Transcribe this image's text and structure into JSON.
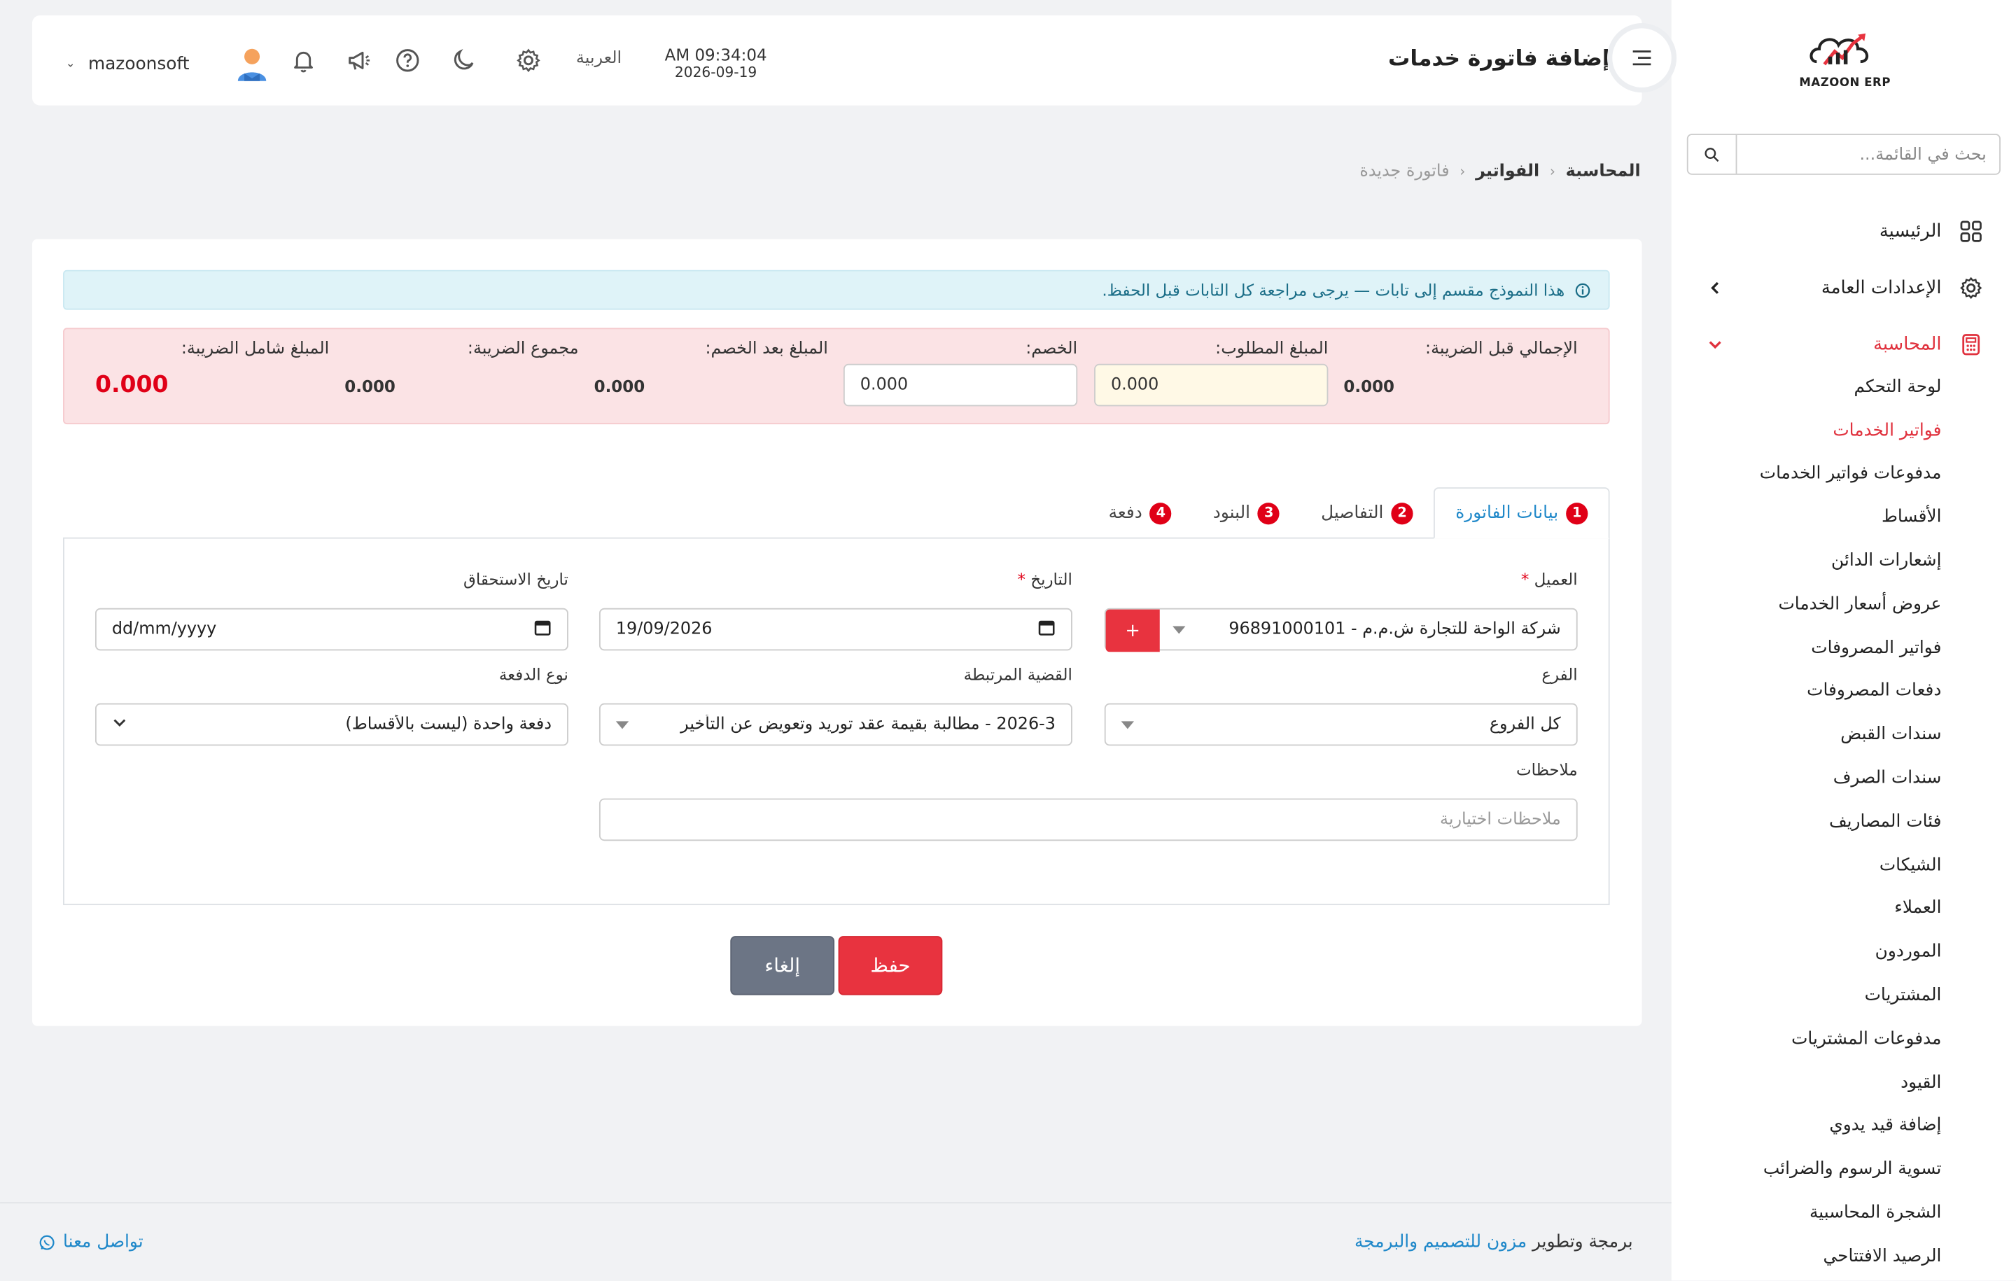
{
  "app": {
    "logo_text": "MAZOON ERP",
    "page_title": "إضافة فاتورة خدمات"
  },
  "header": {
    "time": "AM 09:34:04",
    "date": "2026-09-19",
    "language": "العربية",
    "username": "mazoonsoft"
  },
  "sidebar": {
    "search_placeholder": "بحث في القائمة...",
    "main_items": [
      {
        "label": "الرئيسية",
        "icon": "grid-icon"
      },
      {
        "label": "الإعدادات العامة",
        "icon": "gear-icon"
      },
      {
        "label": "المحاسبة",
        "icon": "calculator-icon"
      }
    ],
    "sub_items": [
      "لوحة التحكم",
      "فواتير الخدمات",
      "مدفوعات فواتير الخدمات",
      "الأقساط",
      "إشعارات الدائن",
      "عروض أسعار الخدمات",
      "فواتير المصروفات",
      "دفعات المصروفات",
      "سندات القبض",
      "سندات الصرف",
      "فئات المصاريف",
      "الشيكات",
      "العملاء",
      "الموردون",
      "المشتريات",
      "مدفوعات المشتريات",
      "القيود",
      "إضافة قيد يدوي",
      "تسوية الرسوم والضرائب",
      "الشجرة المحاسبية",
      "الرصيد الافتتاحي"
    ]
  },
  "breadcrumb": {
    "level1": "المحاسبة",
    "level2": "الفواتير",
    "current": "فاتورة جديدة"
  },
  "alert": {
    "text": "هذا النموذج مقسم إلى تابات — يرجى مراجعة كل التابات قبل الحفظ."
  },
  "summary": {
    "subtotal_label": "الإجمالي قبل الضريبة:",
    "subtotal_value": "0.000",
    "required_label": "المبلغ المطلوب:",
    "required_value": "0.000",
    "discount_label": "الخصم:",
    "discount_value": "0.000",
    "after_discount_label": "المبلغ بعد الخصم:",
    "after_discount_value": "0.000",
    "tax_total_label": "مجموع الضريبة:",
    "tax_total_value": "0.000",
    "grand_total_label": "المبلغ شامل الضريبة:",
    "grand_total_value": "0.000"
  },
  "tabs": [
    {
      "num": "1",
      "label": "بيانات الفاتورة"
    },
    {
      "num": "2",
      "label": "التفاصيل"
    },
    {
      "num": "3",
      "label": "البنود"
    },
    {
      "num": "4",
      "label": "دفعة"
    }
  ],
  "form": {
    "client_label": "العميل",
    "client_value": "شركة الواحة للتجارة ش.م.م - 96891000101",
    "add_label": "+",
    "date_label": "التاريخ",
    "date_value": "19/09/2026",
    "due_date_label": "تاريخ الاستحقاق",
    "due_date_value": "dd/mm/yyyy",
    "branch_label": "الفرع",
    "branch_value": "كل الفروع",
    "case_label": "القضية المرتبطة",
    "case_value": "2026-3 - مطالبة بقيمة عقد توريد وتعويض عن التأخير",
    "payment_type_label": "نوع الدفعة",
    "payment_type_value": "دفعة واحدة (ليست بالأقساط)",
    "notes_label": "ملاحظات",
    "notes_placeholder": "ملاحظات اختيارية",
    "required_mark": "*"
  },
  "actions": {
    "save": "حفظ",
    "cancel": "إلغاء"
  },
  "footer": {
    "credit_prefix": "برمجة وتطوير",
    "credit_link": "مزون للتصميم والبرمجة",
    "contact": "تواصل معنا"
  },
  "colors": {
    "accent_red": "#e00017",
    "link_blue": "#1f88c9",
    "summary_bg": "#fbe3e5",
    "alert_bg": "#dff3f8"
  }
}
